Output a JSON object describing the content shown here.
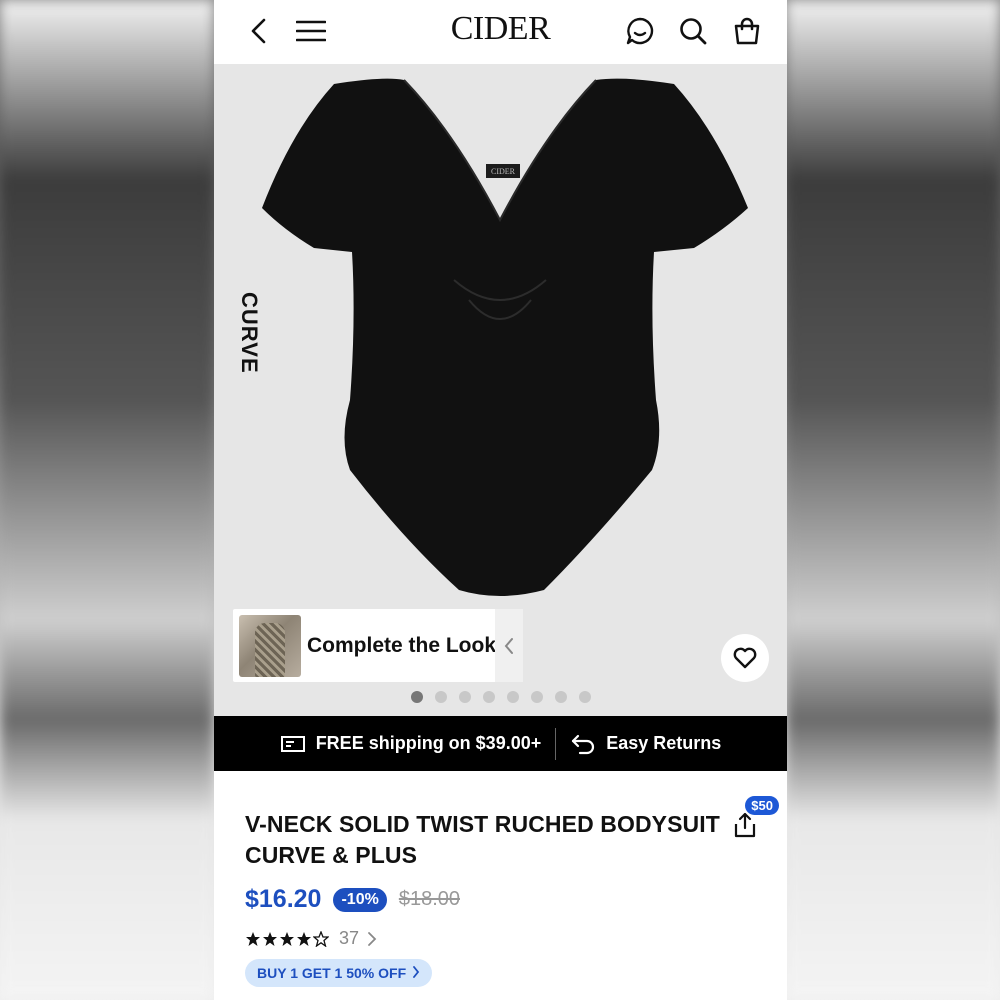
{
  "header": {
    "logo": "CIDER"
  },
  "hero": {
    "side_label": "CURVE",
    "complete_look_label": "Complete the Look",
    "dots_count": 8,
    "active_dot": 0
  },
  "shipping_bar": {
    "shipping_text": "FREE shipping on $39.00+",
    "returns_text": "Easy Returns"
  },
  "product": {
    "title": "V-NECK SOLID TWIST RUCHED BODYSUIT CURVE & PLUS",
    "price": "$16.20",
    "discount": "-10%",
    "original_price": "$18.00",
    "rating": 4,
    "rating_count": "37",
    "share_badge": "$50",
    "promo": "BUY 1 GET 1 50% OFF"
  },
  "colors": {
    "price_blue": "#1d4fbf",
    "promo_bg": "#d4e6fb",
    "bar_black": "#000000"
  }
}
